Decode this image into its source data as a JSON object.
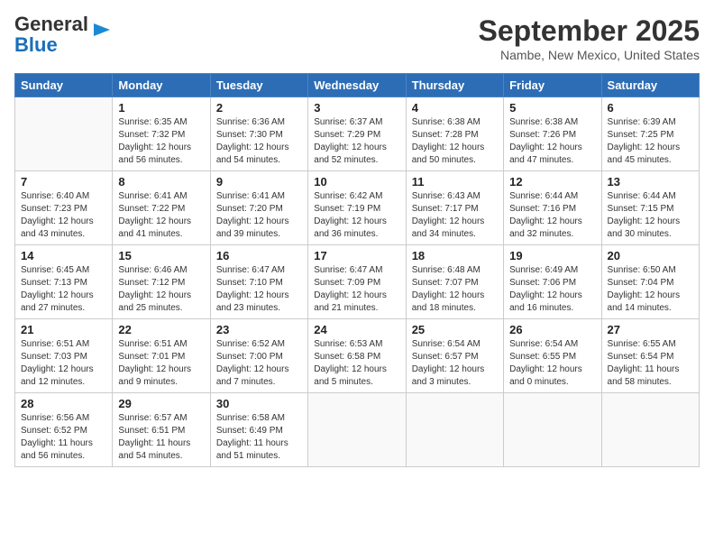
{
  "header": {
    "logo_general": "General",
    "logo_blue": "Blue",
    "title": "September 2025",
    "subtitle": "Nambe, New Mexico, United States"
  },
  "calendar": {
    "days_of_week": [
      "Sunday",
      "Monday",
      "Tuesday",
      "Wednesday",
      "Thursday",
      "Friday",
      "Saturday"
    ],
    "weeks": [
      [
        {
          "day": "",
          "info": ""
        },
        {
          "day": "1",
          "info": "Sunrise: 6:35 AM\nSunset: 7:32 PM\nDaylight: 12 hours\nand 56 minutes."
        },
        {
          "day": "2",
          "info": "Sunrise: 6:36 AM\nSunset: 7:30 PM\nDaylight: 12 hours\nand 54 minutes."
        },
        {
          "day": "3",
          "info": "Sunrise: 6:37 AM\nSunset: 7:29 PM\nDaylight: 12 hours\nand 52 minutes."
        },
        {
          "day": "4",
          "info": "Sunrise: 6:38 AM\nSunset: 7:28 PM\nDaylight: 12 hours\nand 50 minutes."
        },
        {
          "day": "5",
          "info": "Sunrise: 6:38 AM\nSunset: 7:26 PM\nDaylight: 12 hours\nand 47 minutes."
        },
        {
          "day": "6",
          "info": "Sunrise: 6:39 AM\nSunset: 7:25 PM\nDaylight: 12 hours\nand 45 minutes."
        }
      ],
      [
        {
          "day": "7",
          "info": "Sunrise: 6:40 AM\nSunset: 7:23 PM\nDaylight: 12 hours\nand 43 minutes."
        },
        {
          "day": "8",
          "info": "Sunrise: 6:41 AM\nSunset: 7:22 PM\nDaylight: 12 hours\nand 41 minutes."
        },
        {
          "day": "9",
          "info": "Sunrise: 6:41 AM\nSunset: 7:20 PM\nDaylight: 12 hours\nand 39 minutes."
        },
        {
          "day": "10",
          "info": "Sunrise: 6:42 AM\nSunset: 7:19 PM\nDaylight: 12 hours\nand 36 minutes."
        },
        {
          "day": "11",
          "info": "Sunrise: 6:43 AM\nSunset: 7:17 PM\nDaylight: 12 hours\nand 34 minutes."
        },
        {
          "day": "12",
          "info": "Sunrise: 6:44 AM\nSunset: 7:16 PM\nDaylight: 12 hours\nand 32 minutes."
        },
        {
          "day": "13",
          "info": "Sunrise: 6:44 AM\nSunset: 7:15 PM\nDaylight: 12 hours\nand 30 minutes."
        }
      ],
      [
        {
          "day": "14",
          "info": "Sunrise: 6:45 AM\nSunset: 7:13 PM\nDaylight: 12 hours\nand 27 minutes."
        },
        {
          "day": "15",
          "info": "Sunrise: 6:46 AM\nSunset: 7:12 PM\nDaylight: 12 hours\nand 25 minutes."
        },
        {
          "day": "16",
          "info": "Sunrise: 6:47 AM\nSunset: 7:10 PM\nDaylight: 12 hours\nand 23 minutes."
        },
        {
          "day": "17",
          "info": "Sunrise: 6:47 AM\nSunset: 7:09 PM\nDaylight: 12 hours\nand 21 minutes."
        },
        {
          "day": "18",
          "info": "Sunrise: 6:48 AM\nSunset: 7:07 PM\nDaylight: 12 hours\nand 18 minutes."
        },
        {
          "day": "19",
          "info": "Sunrise: 6:49 AM\nSunset: 7:06 PM\nDaylight: 12 hours\nand 16 minutes."
        },
        {
          "day": "20",
          "info": "Sunrise: 6:50 AM\nSunset: 7:04 PM\nDaylight: 12 hours\nand 14 minutes."
        }
      ],
      [
        {
          "day": "21",
          "info": "Sunrise: 6:51 AM\nSunset: 7:03 PM\nDaylight: 12 hours\nand 12 minutes."
        },
        {
          "day": "22",
          "info": "Sunrise: 6:51 AM\nSunset: 7:01 PM\nDaylight: 12 hours\nand 9 minutes."
        },
        {
          "day": "23",
          "info": "Sunrise: 6:52 AM\nSunset: 7:00 PM\nDaylight: 12 hours\nand 7 minutes."
        },
        {
          "day": "24",
          "info": "Sunrise: 6:53 AM\nSunset: 6:58 PM\nDaylight: 12 hours\nand 5 minutes."
        },
        {
          "day": "25",
          "info": "Sunrise: 6:54 AM\nSunset: 6:57 PM\nDaylight: 12 hours\nand 3 minutes."
        },
        {
          "day": "26",
          "info": "Sunrise: 6:54 AM\nSunset: 6:55 PM\nDaylight: 12 hours\nand 0 minutes."
        },
        {
          "day": "27",
          "info": "Sunrise: 6:55 AM\nSunset: 6:54 PM\nDaylight: 11 hours\nand 58 minutes."
        }
      ],
      [
        {
          "day": "28",
          "info": "Sunrise: 6:56 AM\nSunset: 6:52 PM\nDaylight: 11 hours\nand 56 minutes."
        },
        {
          "day": "29",
          "info": "Sunrise: 6:57 AM\nSunset: 6:51 PM\nDaylight: 11 hours\nand 54 minutes."
        },
        {
          "day": "30",
          "info": "Sunrise: 6:58 AM\nSunset: 6:49 PM\nDaylight: 11 hours\nand 51 minutes."
        },
        {
          "day": "",
          "info": ""
        },
        {
          "day": "",
          "info": ""
        },
        {
          "day": "",
          "info": ""
        },
        {
          "day": "",
          "info": ""
        }
      ]
    ]
  }
}
